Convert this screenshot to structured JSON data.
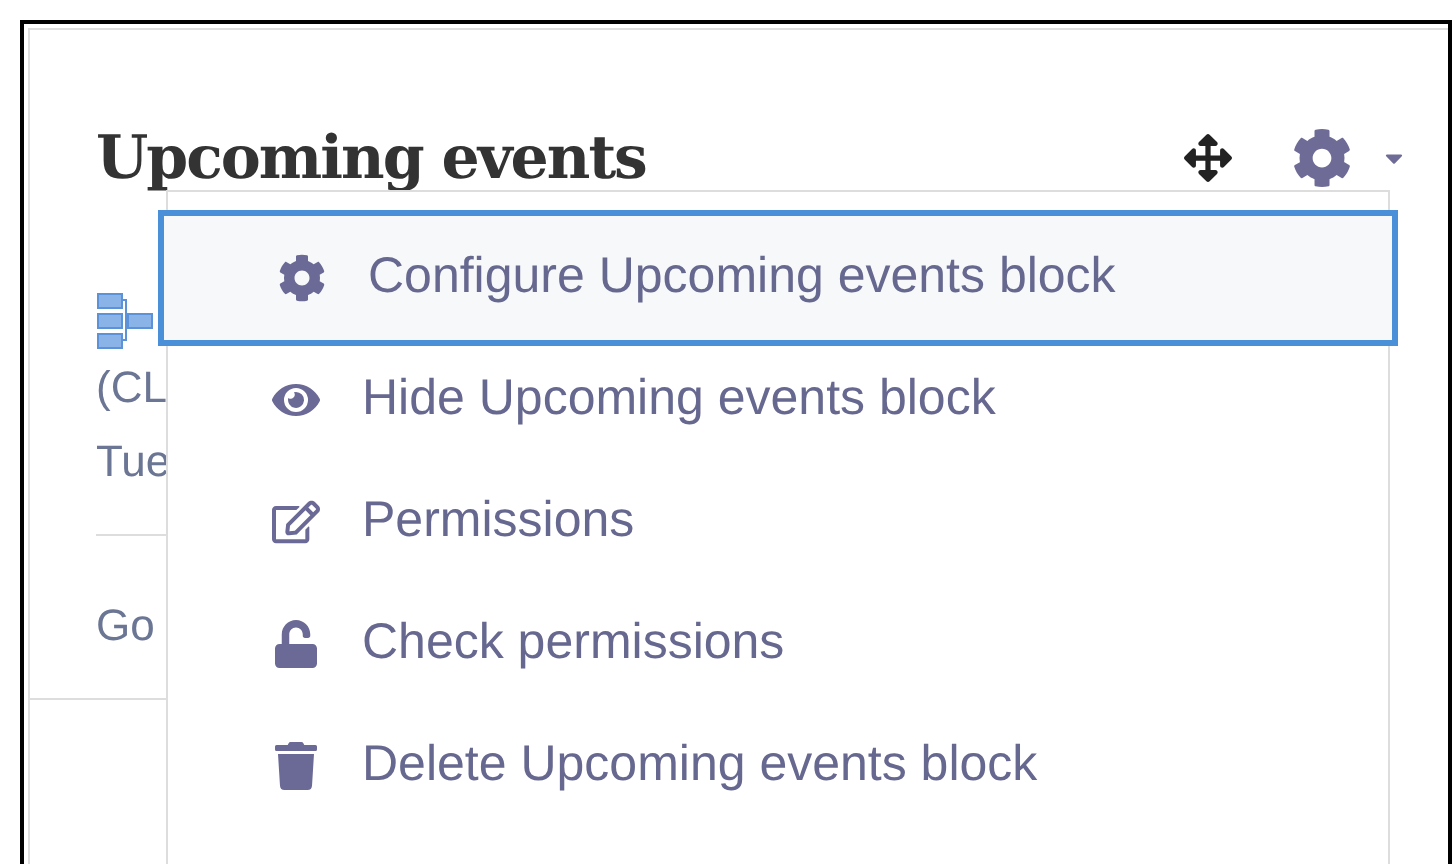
{
  "block": {
    "title": "Upcoming events",
    "event_lines": [
      "(CL",
      "Tue"
    ],
    "footer_link": "Go"
  },
  "menu": {
    "items": [
      {
        "label": "Configure Upcoming events block",
        "kind": "configure",
        "selected": true
      },
      {
        "label": "Hide Upcoming events block",
        "kind": "hide",
        "selected": false
      },
      {
        "label": "Permissions",
        "kind": "permissions",
        "selected": false
      },
      {
        "label": "Check permissions",
        "kind": "check",
        "selected": false
      },
      {
        "label": "Delete Upcoming events block",
        "kind": "delete",
        "selected": false
      }
    ]
  }
}
